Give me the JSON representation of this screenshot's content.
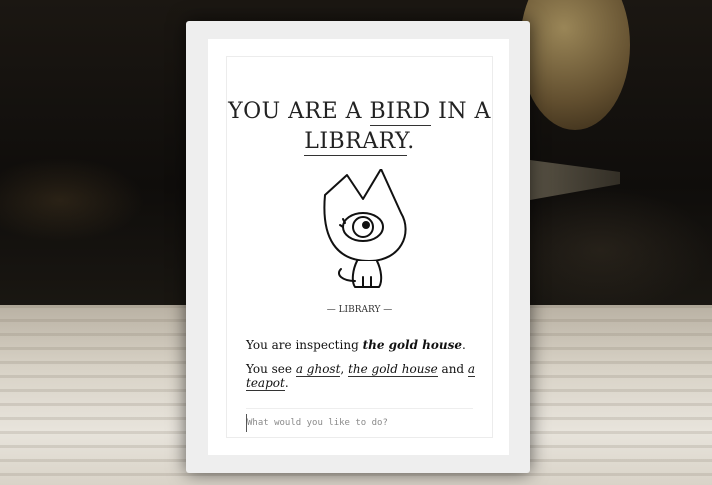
{
  "game": {
    "title_parts": [
      "YOU ARE A ",
      "BIRD",
      " IN A ",
      "LIBRARY",
      "."
    ],
    "location_caption": "— LIBRARY —",
    "status": {
      "prefix": "You are inspecting ",
      "target": "the gold house",
      "suffix": "."
    },
    "objects": {
      "prefix": "You see ",
      "items": [
        "a ghost",
        "the gold house",
        "a teapot"
      ],
      "sep1": ", ",
      "sep2": " and ",
      "suffix": "."
    },
    "command": {
      "placeholder": "What would you like to do?",
      "value": ""
    }
  },
  "icons": [
    "cat-creature-icon"
  ]
}
